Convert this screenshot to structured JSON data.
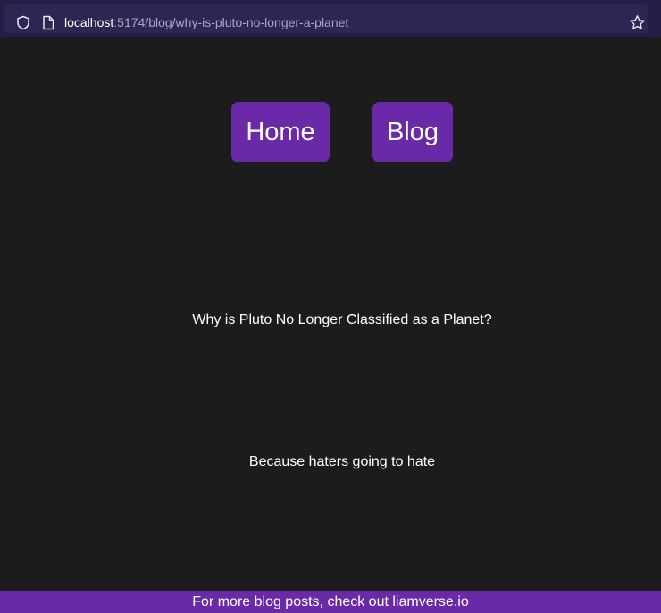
{
  "browser": {
    "url_host": "localhost",
    "url_path": ":5174/blog/why-is-pluto-no-longer-a-planet"
  },
  "nav": {
    "home_label": "Home",
    "blog_label": "Blog"
  },
  "post": {
    "title": "Why is Pluto No Longer Classified as a Planet?",
    "body": "Because haters going to hate"
  },
  "footer": {
    "text": "For more blog posts, check out liamverse.io"
  },
  "colors": {
    "background": "#1c1c1c",
    "accent": "#6a2aa8",
    "toolbar": "#231f45"
  },
  "icons": [
    "shield-icon",
    "page-icon",
    "star-icon"
  ]
}
